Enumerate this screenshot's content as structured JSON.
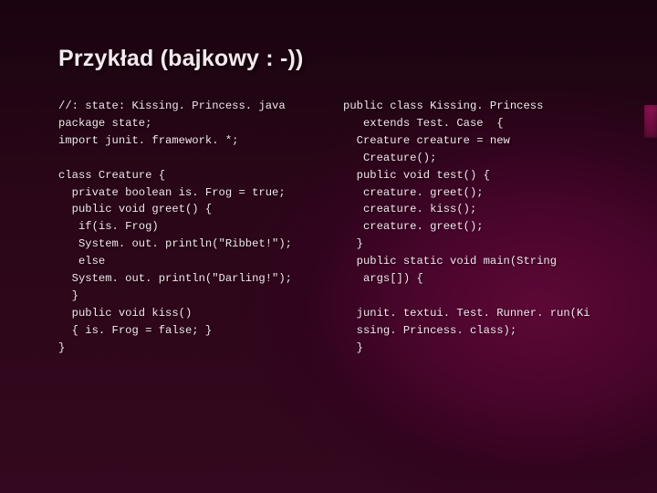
{
  "title": "Przykład (bajkowy : -))",
  "code": {
    "left": "//: state: Kissing. Princess. java\npackage state;\nimport junit. framework. *;\n\nclass Creature {\n  private boolean is. Frog = true;\n  public void greet() {\n   if(is. Frog)\n   System. out. println(\"Ribbet!\");\n   else\n  System. out. println(\"Darling!\");\n  }\n  public void kiss()\n  { is. Frog = false; }\n}",
    "right": "public class Kissing. Princess\n   extends Test. Case  {\n  Creature creature = new\n   Creature();\n  public void test() {\n   creature. greet();\n   creature. kiss();\n   creature. greet();\n  }\n  public static void main(String\n   args[]) {\n\n  junit. textui. Test. Runner. run(Ki\n  ssing. Princess. class);\n  }"
  }
}
